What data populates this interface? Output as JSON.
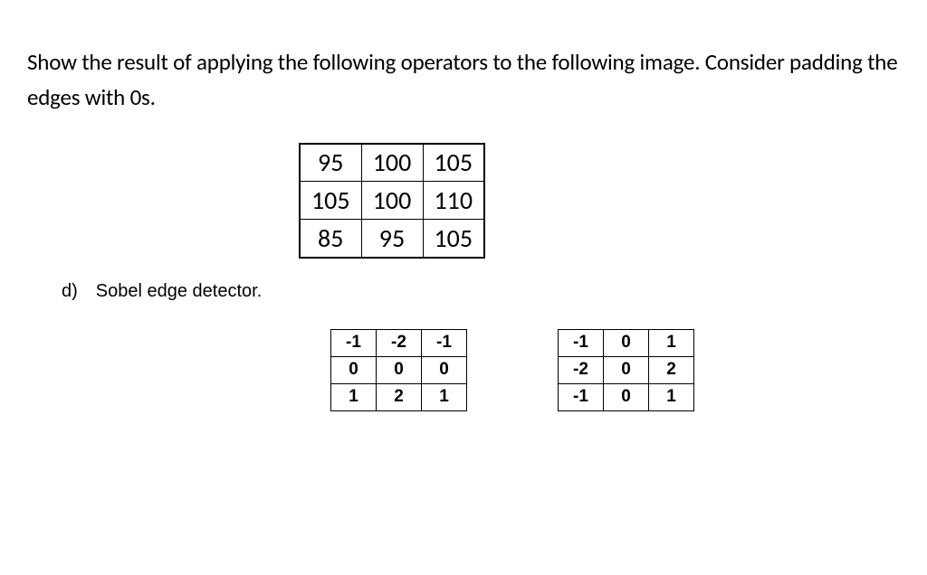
{
  "question": {
    "line1": "Show the result of applying the following operators to the following image. Consider padding the",
    "line2": "edges with 0s."
  },
  "image": {
    "rows": [
      [
        "95",
        "100",
        "105"
      ],
      [
        "105",
        "100",
        "110"
      ],
      [
        "85",
        "95",
        "105"
      ]
    ]
  },
  "part": {
    "label": "d) Sobel edge detector."
  },
  "kernel1": {
    "rows": [
      [
        "-1",
        "-2",
        "-1"
      ],
      [
        "0",
        "0",
        "0"
      ],
      [
        "1",
        "2",
        "1"
      ]
    ]
  },
  "kernel2": {
    "rows": [
      [
        "-1",
        "0",
        "1"
      ],
      [
        "-2",
        "0",
        "2"
      ],
      [
        "-1",
        "0",
        "1"
      ]
    ]
  },
  "chart_data": [
    {
      "type": "table",
      "title": "Input image",
      "rows": [
        [
          95,
          100,
          105
        ],
        [
          105,
          100,
          110
        ],
        [
          85,
          95,
          105
        ]
      ]
    },
    {
      "type": "table",
      "title": "Sobel kernel (vertical gradient)",
      "rows": [
        [
          -1,
          -2,
          -1
        ],
        [
          0,
          0,
          0
        ],
        [
          1,
          2,
          1
        ]
      ]
    },
    {
      "type": "table",
      "title": "Sobel kernel (horizontal gradient)",
      "rows": [
        [
          -1,
          0,
          1
        ],
        [
          -2,
          0,
          2
        ],
        [
          -1,
          0,
          1
        ]
      ]
    }
  ]
}
